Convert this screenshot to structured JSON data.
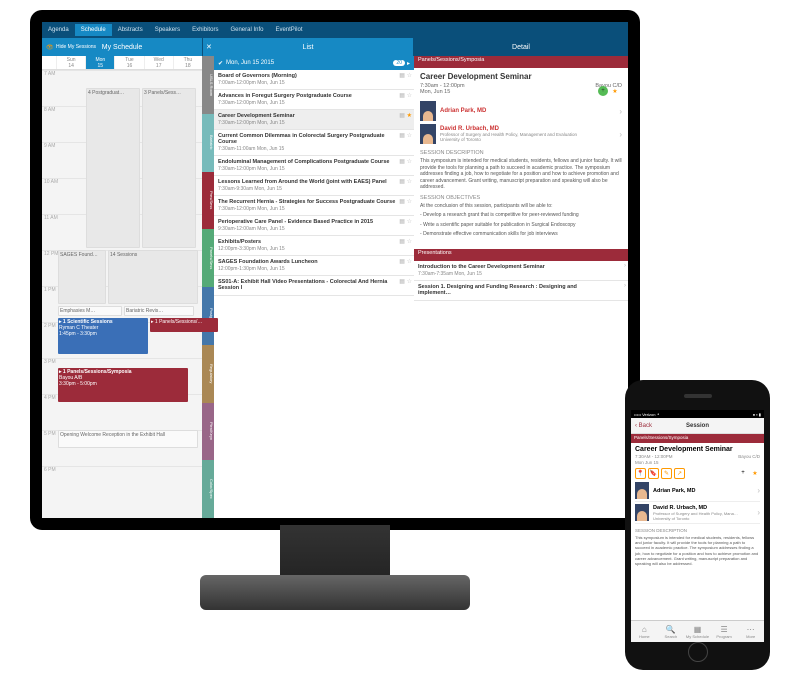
{
  "nav": {
    "items": [
      "Agenda",
      "Schedule",
      "Abstracts",
      "Speakers",
      "Exhibitors",
      "General Info",
      "EventPilot"
    ],
    "active": "Schedule"
  },
  "columns": {
    "schedule": "My Schedule",
    "hide": "Hide My Sessions",
    "list": "List",
    "detail": "Detail"
  },
  "days": [
    {
      "dow": "Sun",
      "num": "14"
    },
    {
      "dow": "Mon",
      "num": "15"
    },
    {
      "dow": "Tue",
      "num": "16"
    },
    {
      "dow": "Wed",
      "num": "17"
    },
    {
      "dow": "Thu",
      "num": "18"
    }
  ],
  "hours": [
    "7 AM",
    "8 AM",
    "9 AM",
    "10 AM",
    "11 AM",
    "12 PM",
    "1 PM",
    "2 PM",
    "3 PM",
    "4 PM",
    "5 PM",
    "6 PM"
  ],
  "cal": {
    "pg": "4 Postgraduat…",
    "ps": "3 Panels/Sess…",
    "sf": "SAGES Found…",
    "ss": "14 Sessions",
    "em": "Emphasies M…",
    "br": "Bariatric Revis…",
    "sci": {
      "badge": "1 Scientific Sessions",
      "loc": "Ryman C Theater",
      "time": "1:45pm - 3:30pm"
    },
    "pan": {
      "badge": "1 Panels/Sessions/Symposia",
      "loc": "Bayou A/B",
      "time": "3:30pm - 5:00pm"
    },
    "psm": "1 Panels/Sessions/…",
    "welcome": "Opening Welcome Reception in the Exhibit Hall"
  },
  "listDate": "Mon, Jun 15 2015",
  "listTabs": [
    "USLS Room",
    "Bariatric",
    "Pres/Sess",
    "Panels/Sess",
    "Postgrad",
    "Regulatory",
    "Plen/Keyn",
    "Color/Spec"
  ],
  "list": [
    {
      "t": "Board of Governors (Morning)",
      "d": "7:00am-12:00pm Mon, Jun 15"
    },
    {
      "t": "Advances in Foregut Surgery Postgraduate Course",
      "d": "7:30am-12:00pm Mon, Jun 15"
    },
    {
      "t": "Career Development Seminar",
      "d": "7:30am-12:00pm Mon, Jun 15",
      "sel": true,
      "starred": true
    },
    {
      "t": "Current Common Dilemmas in Colorectal Surgery Postgraduate Course",
      "d": "7:30am-11:00am Mon, Jun 15"
    },
    {
      "t": "Endoluminal Management of Complications Postgraduate Course",
      "d": "7:30am-12:00pm Mon, Jun 15"
    },
    {
      "t": "Lessons Learned from Around the World (joint with EAES) Panel",
      "d": "7:30am-9:30am Mon, Jun 15"
    },
    {
      "t": "The Recurrent Hernia - Strategies for Success Postgraduate Course",
      "d": "7:30am-12:00pm Mon, Jun 15"
    },
    {
      "t": "Perioperative Care Panel - Evidence Based Practice in 2015",
      "d": "9:30am-12:00am Mon, Jun 15"
    },
    {
      "t": "Exhibits/Posters",
      "d": "12:00pm-3:30pm Mon, Jun 15"
    },
    {
      "t": "SAGES Foundation Awards Luncheon",
      "d": "12:00pm-1:30pm Mon, Jun 15"
    },
    {
      "t": "SS01-A: Exhibit Hall Video Presentations - Colorectal And Hernia Session I",
      "d": ""
    }
  ],
  "detail": {
    "cat": "Panels/Sessions/Symposia",
    "title": "Career Development Seminar",
    "time": "7:30am - 12:00pm",
    "date": "Mon, Jun 15",
    "room": "Bayou C/D",
    "speakers": [
      {
        "name": "Adrian Park, MD",
        "role": ""
      },
      {
        "name": "David R. Urbach, MD",
        "role": "Professor of Surgery and Health Policy, Management and Evaluation",
        "org": "University of Toronto"
      }
    ],
    "descHead": "SESSION DESCRIPTION",
    "desc": "This symposium is intended for medical students, residents, fellows and junior faculty. It will provide the tools for planning a path to succeed in academic practice. The symposium addresses finding a job, how to negotiate for a position and how to achieve promotion and career advancement. Grant writing, manuscript preparation and speaking will also be addressed.",
    "objHead": "SESSION OBJECTIVES",
    "objIntro": "At the conclusion of this session, participants will be able to:",
    "objs": [
      "Develop a research grant that is competitive for peer-reviewed funding",
      "Write a scientific paper suitable for publication in Surgical Endoscopy",
      "Demonstrate effective communication skills for job interviews"
    ],
    "presHead": "Presentations",
    "pres": [
      {
        "t": "Introduction to the Career Development Seminar",
        "d": "7:30am-7:35am Mon, Jun 15"
      },
      {
        "t": "Session 1. Designing and Funding Research : Designing and implement…",
        "d": ""
      }
    ]
  },
  "phone": {
    "carrier": "••••• Verizon ⚬",
    "clock": "",
    "batt": "● ▪ ▮",
    "back": "Back",
    "title": "Session",
    "cat": "Panels/Sessions/Symposia",
    "t": "Career Development Seminar",
    "time": "7:30AM - 12:00PM",
    "date": "Mon Jun 15",
    "room": "Bayou C/D",
    "speakers": [
      {
        "name": "Adrian Park, MD"
      },
      {
        "name": "David R. Urbach, MD",
        "role": "Professor of Surgery and Health Policy, Mana…",
        "org": "University of Toronto"
      }
    ],
    "descHead": "SESSION DESCRIPTION",
    "desc": "This symposium is intended for medical students, residents, fellows and junior faculty. It will provide the tools for planning a path to succeed in academic practice. The symposium addresses finding a job, how to negotiate for a position and how to achieve promotion and career advancement. Grant writing, manuscript preparation and speaking will also be addressed.",
    "tabs": [
      "Home",
      "Search",
      "My Schedule",
      "Program",
      "More"
    ]
  }
}
